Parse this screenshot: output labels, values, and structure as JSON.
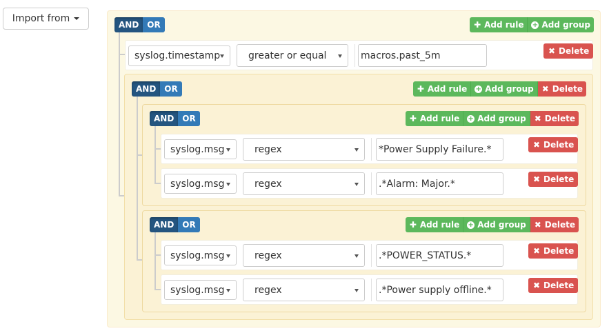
{
  "import_button": {
    "label": "Import from"
  },
  "labels": {
    "and": "AND",
    "or": "OR",
    "add_rule": "Add rule",
    "add_group": "Add group",
    "delete": "Delete",
    "plus_icon": "✚",
    "delete_icon": "✖"
  },
  "icons": {
    "add_rule": "plus-icon",
    "add_group": "plus-circle-icon",
    "delete": "times-icon"
  },
  "colors": {
    "and_active": "#245580",
    "or": "#337ab7",
    "success": "#5cb85c",
    "danger": "#d9534f",
    "group_bg": "#fcf8e3"
  },
  "root": {
    "condition": "AND",
    "rule1": {
      "field": "syslog.timestamp",
      "operator": "greater or equal",
      "value": "macros.past_5m"
    },
    "group1": {
      "condition": "AND",
      "sub1": {
        "condition": "AND",
        "rule1": {
          "field": "syslog.msg",
          "operator": "regex",
          "value": "*Power Supply Failure.*"
        },
        "rule2": {
          "field": "syslog.msg",
          "operator": "regex",
          "value": ".*Alarm: Major.*"
        }
      },
      "sub2": {
        "condition": "AND",
        "rule1": {
          "field": "syslog.msg",
          "operator": "regex",
          "value": ".*POWER_STATUS.*"
        },
        "rule2": {
          "field": "syslog.msg",
          "operator": "regex",
          "value": ".*Power supply offline.*"
        }
      }
    }
  }
}
